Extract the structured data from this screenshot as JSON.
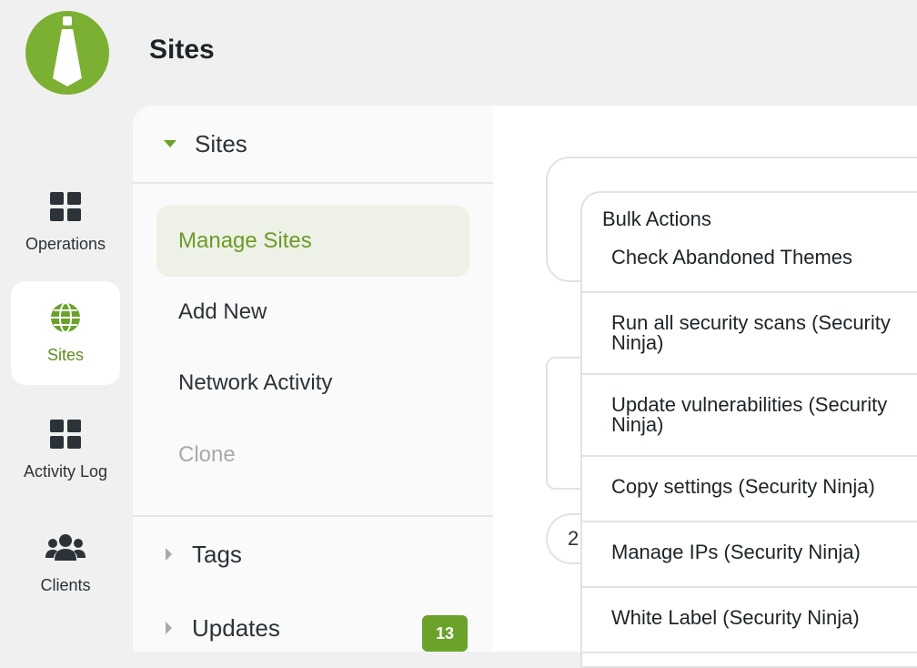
{
  "header": {
    "title": "Sites"
  },
  "rail": {
    "items": [
      {
        "label": "Operations",
        "icon": "grid-icon"
      },
      {
        "label": "Sites",
        "icon": "globe-icon",
        "active": true
      },
      {
        "label": "Activity Log",
        "icon": "grid-icon"
      },
      {
        "label": "Clients",
        "icon": "users-icon"
      }
    ]
  },
  "submenu": {
    "header": "Sites",
    "items": [
      {
        "label": "Manage Sites",
        "active": true
      },
      {
        "label": "Add New"
      },
      {
        "label": "Network Activity"
      },
      {
        "label": "Clone",
        "disabled": true
      }
    ],
    "groups": [
      {
        "label": "Tags"
      },
      {
        "label": "Updates",
        "badge": "13"
      }
    ]
  },
  "main": {
    "pager_text": "2",
    "bulk_actions": {
      "placeholder": "Bulk Actions",
      "options": [
        "Check Abandoned Themes",
        "Run all security scans (Security Ninja)",
        "Update vulnerabilities (Security Ninja)",
        "Copy settings (Security Ninja)",
        "Manage IPs (Security Ninja)",
        "White Label (Security Ninja)"
      ]
    }
  },
  "colors": {
    "brand_green": "#7cb032",
    "active_text": "#6b9b2a",
    "active_bg": "#eef1e5",
    "badge_bg": "#6aa22a"
  }
}
